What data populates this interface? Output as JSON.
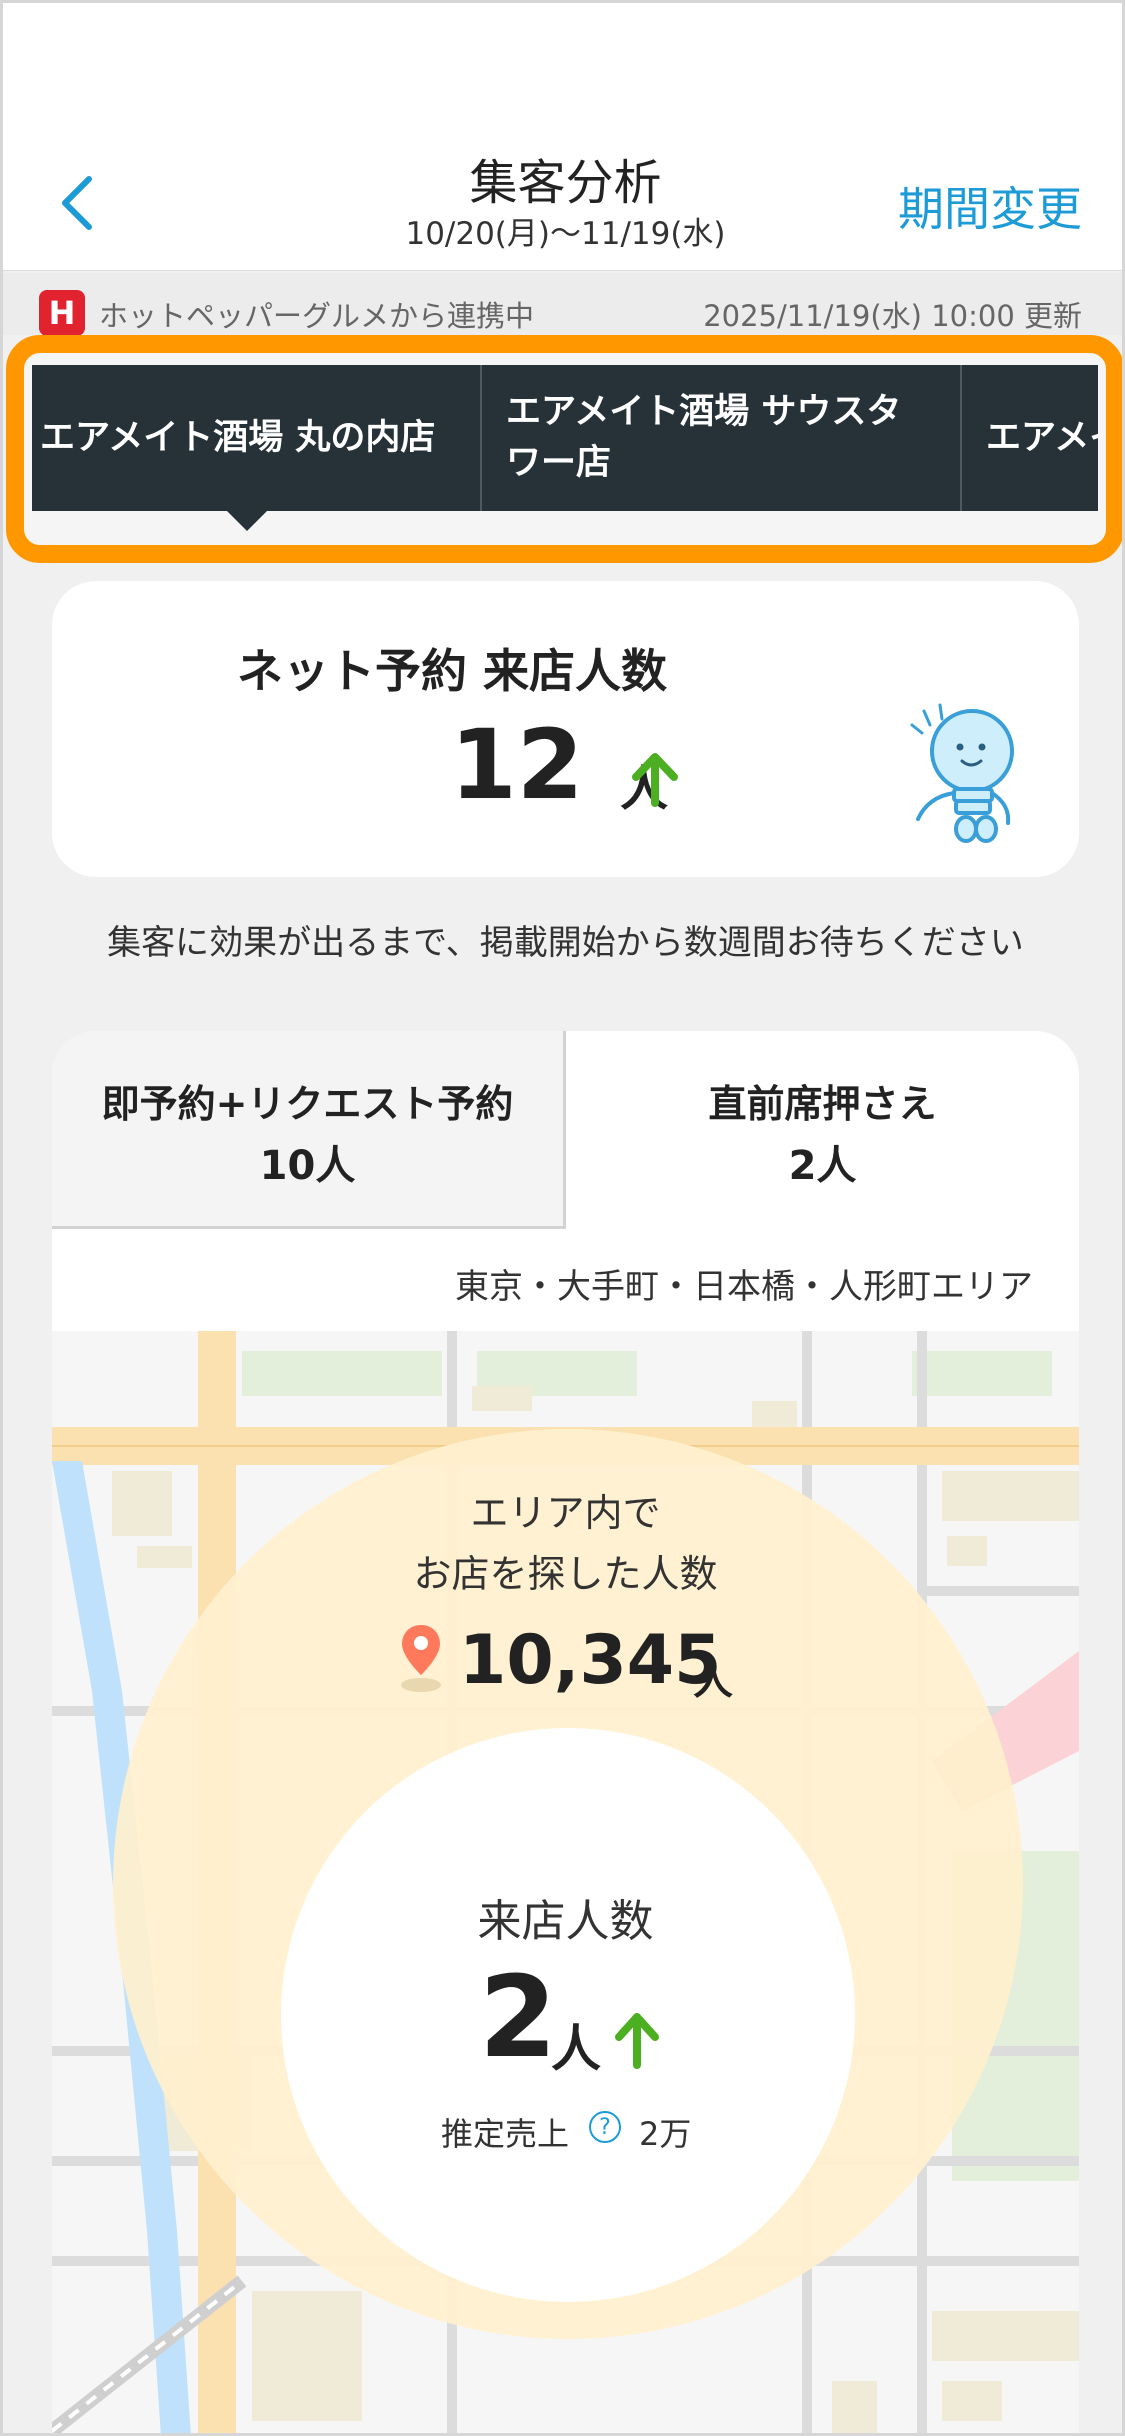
{
  "header": {
    "title": "集客分析",
    "subtitle": "10/20(月)〜11/19(水)",
    "period_button": "期間変更"
  },
  "link_bar": {
    "logo_letter": "H",
    "text": "ホットペッパーグルメから連携中",
    "updated": "2025/11/19(水) 10:00 更新"
  },
  "store_tabs": [
    "エアメイト酒場 丸の内店",
    "エアメイト酒場 サウスタワー店",
    "エアメイ"
  ],
  "summary": {
    "label": "ネット予約 来店人数",
    "value": "12",
    "unit": "人",
    "trend": "up"
  },
  "notice": "集客に効果が出るまで、掲載開始から数週間お待ちください",
  "detail_tabs": [
    {
      "label": "即予約+リクエスト予約",
      "value": "10人"
    },
    {
      "label": "直前席押さえ",
      "value": "2人"
    }
  ],
  "area": {
    "name": "東京・大手町・日本橋・人形町エリア",
    "searchers_label": "エリア内で\nお店を探した人数",
    "searchers_value": "10,345",
    "searchers_unit": "人"
  },
  "visits": {
    "label": "来店人数",
    "value": "2",
    "unit": "人",
    "trend": "up",
    "sales_label": "推定売上",
    "sales_value": "2万"
  },
  "colors": {
    "accent_blue": "#1d9bd7",
    "highlight_orange": "#ff9800",
    "tab_dark": "#263238",
    "trend_green": "#4caf22",
    "circle_cream": "#fff0cd"
  }
}
